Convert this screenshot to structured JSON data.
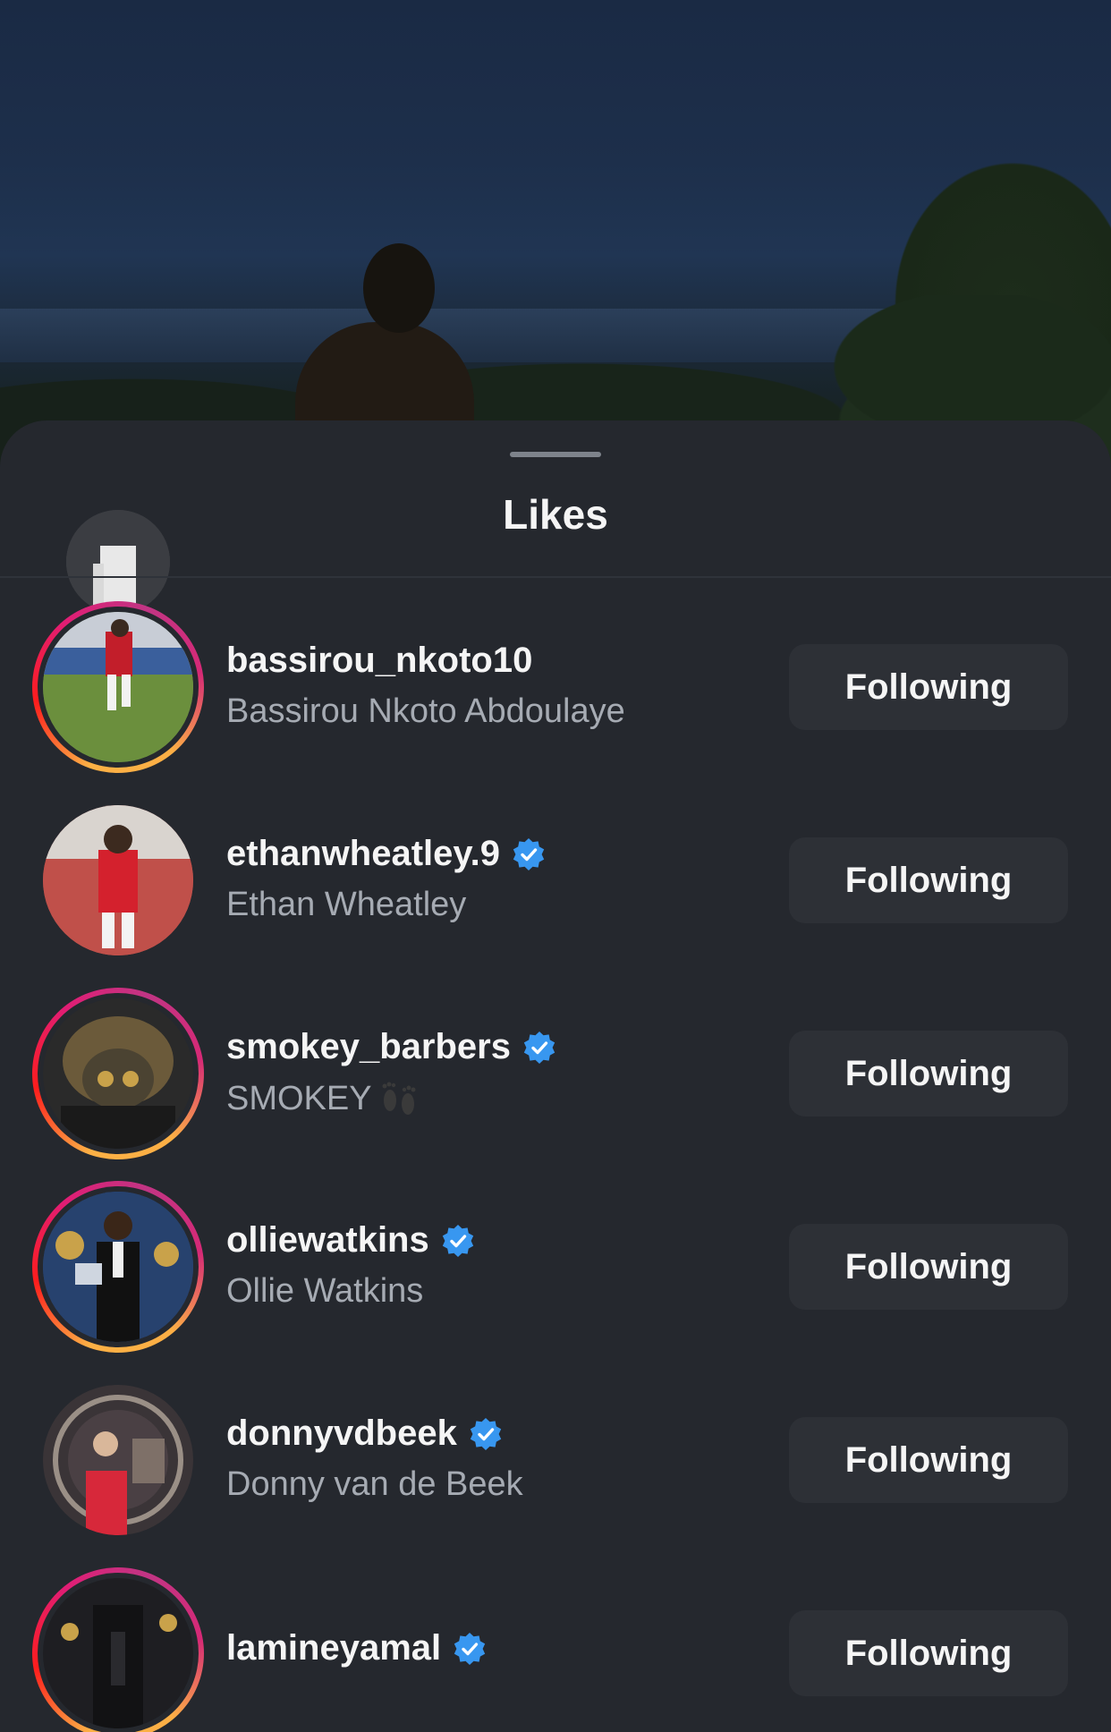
{
  "sheet": {
    "title": "Likes"
  },
  "likes": [
    {
      "username": "bassirou_nkoto10",
      "full_name": "Bassirou Nkoto Abdoulaye",
      "verified": false,
      "story_ring": true,
      "button_label": "Following"
    },
    {
      "username": "ethanwheatley.9",
      "full_name": "Ethan Wheatley",
      "verified": true,
      "story_ring": false,
      "button_label": "Following"
    },
    {
      "username": "smokey_barbers",
      "full_name": "SMOKEY",
      "full_name_icon": "footprints-emoji-icon",
      "verified": true,
      "story_ring": true,
      "button_label": "Following"
    },
    {
      "username": "olliewatkins",
      "full_name": "Ollie Watkins",
      "verified": true,
      "story_ring": true,
      "button_label": "Following"
    },
    {
      "username": "donnyvdbeek",
      "full_name": "Donny van de Beek",
      "verified": true,
      "story_ring": false,
      "button_label": "Following"
    },
    {
      "username": "lamineyamal",
      "verified": true,
      "story_ring": true,
      "button_label": "Following"
    }
  ],
  "colors": {
    "sheet_bg": "#25282e",
    "button_bg": "#2d3036",
    "verified_blue": "#3897f0",
    "secondary_text": "#a6abb3"
  }
}
